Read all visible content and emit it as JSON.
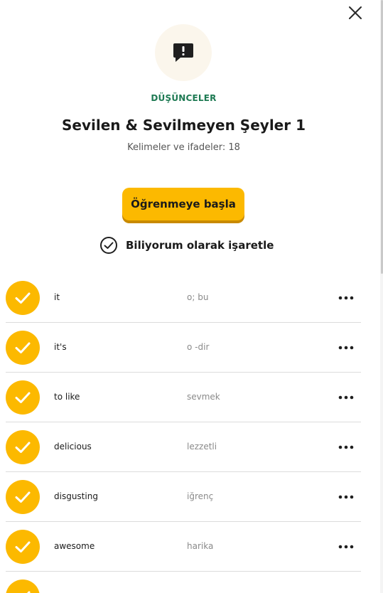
{
  "header": {
    "category": "DÜŞÜNCELER",
    "title": "Sevilen & Sevilmeyen Şeyler 1",
    "subtitle": "Kelimeler ve ifadeler: 18",
    "icon": "speech-bubble-exclamation-icon"
  },
  "actions": {
    "start_label": "Öğrenmeye başla",
    "mark_known_label": "Biliyorum olarak işaretle"
  },
  "colors": {
    "accent": "#fcb900",
    "category": "#1e7a53",
    "icon_bg": "#fbf6ec"
  },
  "words": [
    {
      "term": "it",
      "translation": "o; bu"
    },
    {
      "term": "it's",
      "translation": "o -dir"
    },
    {
      "term": "to like",
      "translation": "sevmek"
    },
    {
      "term": "delicious",
      "translation": "lezzetli"
    },
    {
      "term": "disgusting",
      "translation": "iğrenç"
    },
    {
      "term": "awesome",
      "translation": "harika"
    },
    {
      "term": "",
      "translation": ""
    }
  ]
}
